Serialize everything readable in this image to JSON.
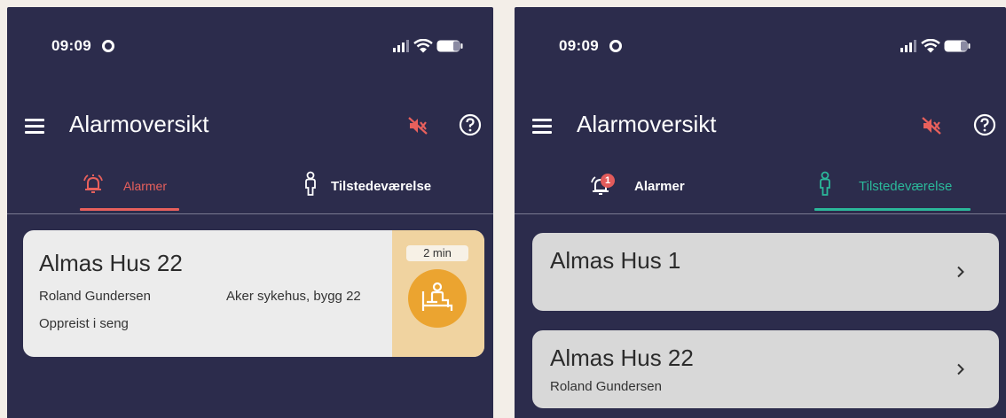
{
  "colors": {
    "background": "#2c2c4c",
    "alarm_accent": "#e8605c",
    "presence_accent": "#2bb89a",
    "alarm_card": "#ececec",
    "alarm_side": "#f0d3a0",
    "alarm_icon": "#eba430",
    "presence_card": "#d8d8d8"
  },
  "left_screen": {
    "status_bar": {
      "time": "09:09"
    },
    "header": {
      "title": "Alarmoversikt",
      "mute_icon": "volume-off-icon",
      "help_icon": "help-circle-icon"
    },
    "tabs": [
      {
        "label": "Alarmer",
        "icon": "bell-ringing-icon",
        "active": true
      },
      {
        "label": "Tilstedeværelse",
        "icon": "person-outline-icon",
        "active": false
      }
    ],
    "alarm": {
      "title": "Almas Hus 22",
      "person": "Roland Gundersen",
      "location": "Aker sykehus, bygg 22",
      "status": "Oppreist i seng",
      "elapsed": "2 min",
      "icon": "person-sitting-in-bed-icon"
    }
  },
  "right_screen": {
    "status_bar": {
      "time": "09:09"
    },
    "header": {
      "title": "Alarmoversikt",
      "mute_icon": "volume-off-icon",
      "help_icon": "help-circle-icon"
    },
    "tabs": [
      {
        "label": "Alarmer",
        "icon": "bell-icon",
        "badge": "1",
        "active": false
      },
      {
        "label": "Tilstedeværelse",
        "icon": "person-outline-icon",
        "active": true
      }
    ],
    "locations": [
      {
        "title": "Almas Hus 1",
        "subtitle": ""
      },
      {
        "title": "Almas Hus 22",
        "subtitle": "Roland Gundersen"
      }
    ]
  }
}
